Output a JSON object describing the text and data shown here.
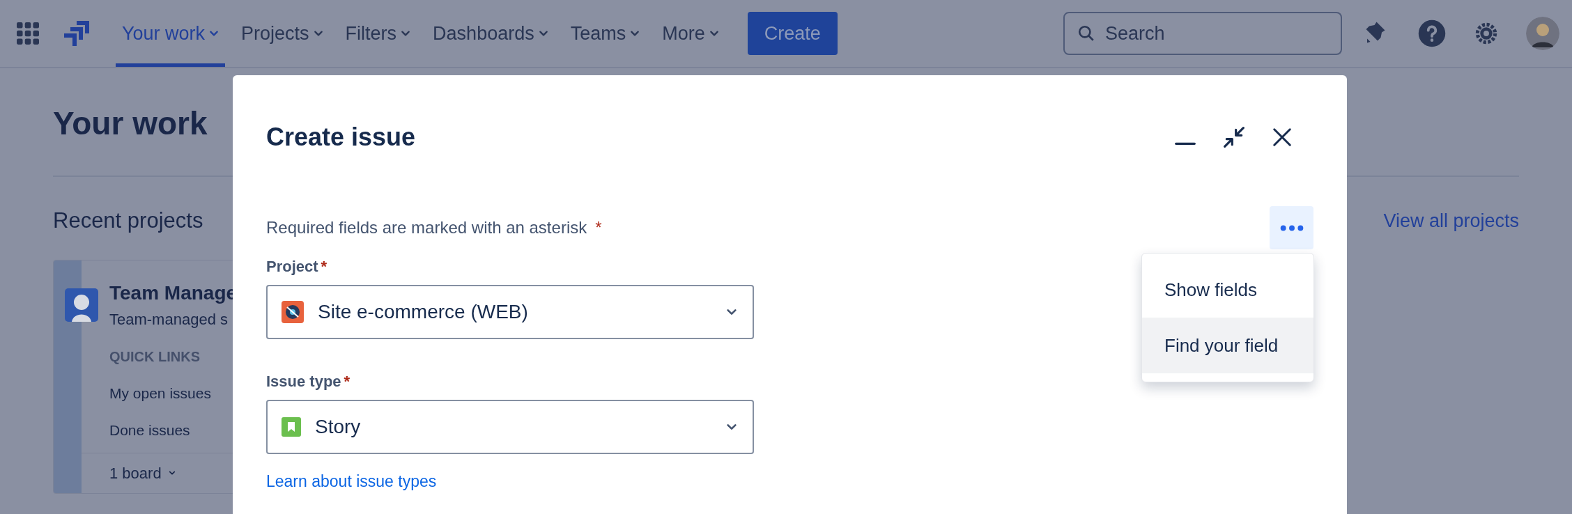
{
  "nav": {
    "items": [
      {
        "label": "Your work",
        "selected": true
      },
      {
        "label": "Projects",
        "selected": false
      },
      {
        "label": "Filters",
        "selected": false
      },
      {
        "label": "Dashboards",
        "selected": false
      },
      {
        "label": "Teams",
        "selected": false
      },
      {
        "label": "More",
        "selected": false
      }
    ],
    "create_button": "Create",
    "search": {
      "placeholder": "Search"
    }
  },
  "page": {
    "title": "Your work",
    "recent_projects": "Recent projects",
    "view_all": "View all projects",
    "project_card": {
      "name": "Team Manage",
      "type": "Team-managed s",
      "quick_links_heading": "QUICK LINKS",
      "links": [
        "My open issues",
        "Done issues"
      ],
      "boards": "1 board"
    }
  },
  "modal": {
    "title": "Create issue",
    "required_note": "Required fields are marked with an asterisk",
    "required_mark": "*",
    "fields": [
      {
        "label": "Project",
        "required_mark": "*",
        "value": "Site e-commerce (WEB)",
        "kind": "project"
      },
      {
        "label": "Issue type",
        "required_mark": "*",
        "value": "Story",
        "kind": "story"
      }
    ],
    "help_link": "Learn about issue types",
    "menu": {
      "open": true,
      "items": [
        {
          "label": "Show fields",
          "highlighted": false
        },
        {
          "label": "Find your field",
          "highlighted": true
        }
      ]
    }
  }
}
